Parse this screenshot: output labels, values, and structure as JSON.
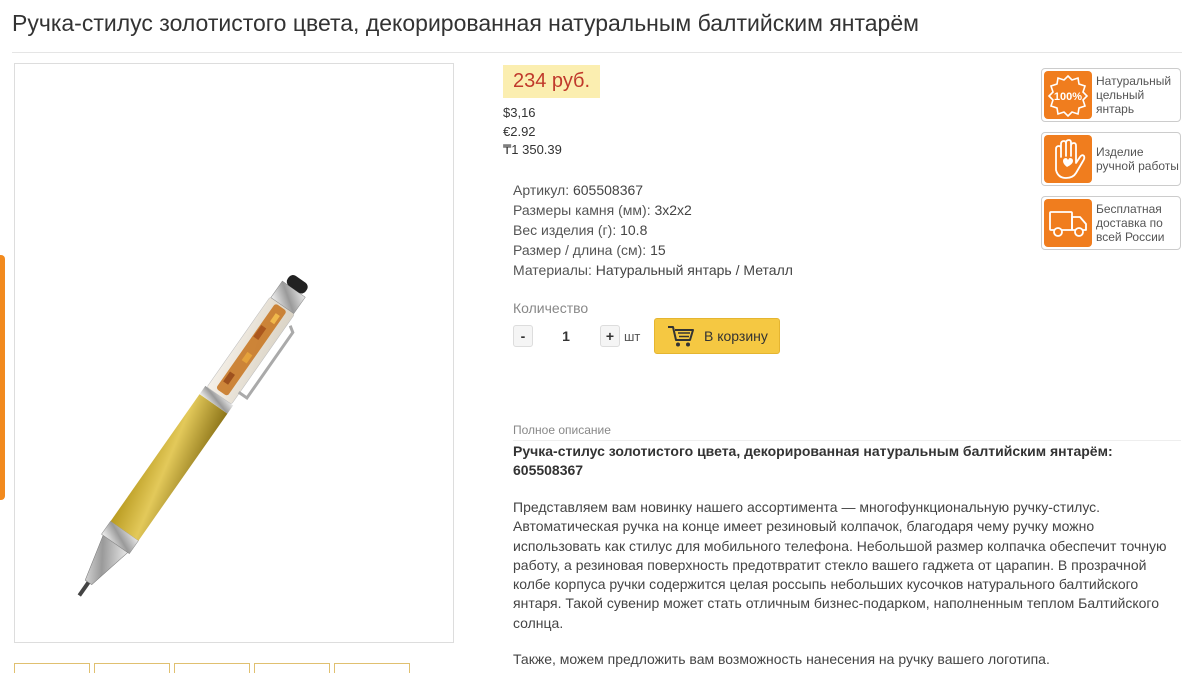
{
  "product": {
    "title": "Ручка-стилус золотистого цвета, декорированная натуральным балтийским янтарём",
    "price": "234 руб.",
    "alt_prices": [
      "$3,16",
      "€2.92",
      "₸1 350.39"
    ]
  },
  "specs": [
    {
      "label": "Артикул:",
      "value": "605508367"
    },
    {
      "label": "Размеры камня (мм):",
      "value": "3х2х2"
    },
    {
      "label": "Вес изделия (г):",
      "value": "10.8"
    },
    {
      "label": "Размер / длина (см):",
      "value": "15"
    },
    {
      "label": "Материалы:",
      "value": "Натуральный янтарь / Металл"
    }
  ],
  "quantity": {
    "label": "Количество",
    "minus": "-",
    "plus": "+",
    "value": "1",
    "unit": "шт",
    "cart_button": "В корзину"
  },
  "badges": [
    {
      "icon": "100-percent-icon",
      "icon_text": "100%",
      "text": [
        "Натуральный",
        "цельный",
        "янтарь"
      ]
    },
    {
      "icon": "hand-heart-icon",
      "text": [
        "Изделие",
        "ручной работы"
      ]
    },
    {
      "icon": "delivery-truck-icon",
      "text": [
        "Бесплатная",
        "доставка по",
        "всей России"
      ]
    }
  ],
  "description": {
    "heading": "Полное описание",
    "title": "Ручка-стилус золотистого цвета, декорированная натуральным балтийским янтарём: 605508367",
    "body": "Представляем вам новинку нашего ассортимента — многофункциональную ручку-стилус. Автоматическая ручка на конце имеет резиновый колпачок, благодаря чему ручку можно использовать как стилус для мобильного телефона. Небольшой размер колпачка обеспечит точную работу, а резиновая поверхность предотвратит стекло вашего гаджета от царапин.  В прозрачной колбе корпуса ручки содержится целая россыпь небольших кусочков натурального балтийского янтаря. Такой сувенир может стать отличным бизнес-подарком, наполненным теплом Балтийского солнца.",
    "body2": "Также, можем предложить вам возможность нанесения на ручку вашего логотипа."
  },
  "colors": {
    "price_bg": "#fbeeb0",
    "price_text": "#c0392b",
    "accent_orange": "#f07d1e",
    "cart_button": "#f5c842"
  }
}
